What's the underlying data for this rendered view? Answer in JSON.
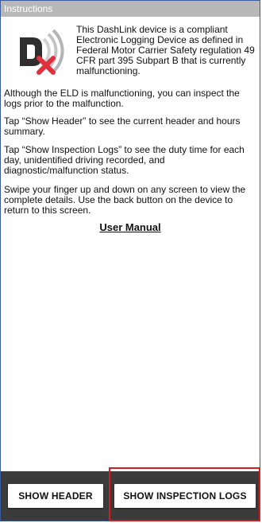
{
  "window": {
    "title": "Instructions"
  },
  "intro": {
    "logo_icon": "dashlink-malfunction-icon",
    "text": "This DashLink device is a compliant Electronic Logging Device as defined in Federal Motor Carrier Safety regulation 49 CFR part 395 Subpart B that is currently malfunctioning."
  },
  "paragraphs": {
    "p1": "Although the ELD is malfunctioning, you can inspect the logs prior to the malfunction.",
    "p2": "Tap “Show Header” to see the current header and hours summary.",
    "p3": "Tap “Show Inspection Logs” to see the duty time for each day, unidentified driving recorded, and diagnostic/malfunction status.",
    "p4": "Swipe your finger up and down on any screen to view the complete details. Use the back button on the device to return to this screen."
  },
  "manual": {
    "label": "User Manual"
  },
  "actions": {
    "show_header_label": "SHOW HEADER",
    "show_logs_label": "SHOW INSPECTION LOGS"
  },
  "colors": {
    "title_bar": "#b8b8b8",
    "bottom_bar": "#3b3b3b",
    "highlight": "#d11f1f",
    "logo_x": "#e0303c",
    "logo_dark": "#2e2e2e"
  }
}
